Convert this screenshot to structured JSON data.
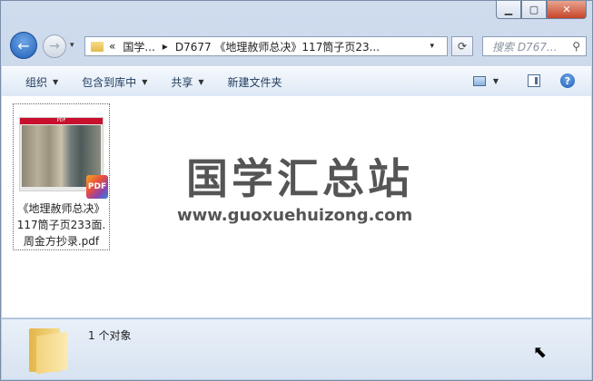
{
  "window": {
    "caption_buttons": {
      "minimize": "▁",
      "maximize": "▢",
      "close": "✕"
    }
  },
  "nav": {
    "back_icon": "←",
    "forward_icon": "→",
    "history_drop": "▾",
    "breadcrumb": [
      "«",
      "国学...",
      "▸",
      "D7677 《地理赦师总决》117筒子页23..."
    ],
    "address_drop": "▾",
    "refresh_icon": "⟳",
    "search_placeholder": "搜索 D767...",
    "search_icon": "⚲"
  },
  "toolbar": {
    "organize": "组织",
    "include_library": "包含到库中",
    "share": "共享",
    "new_folder": "新建文件夹",
    "arrow": "▼",
    "help": "?"
  },
  "file": {
    "thumb_header": "PDF",
    "badge": "PDF",
    "name_line1": "《地理赦师总决》",
    "name_line2": "117筒子页233面.",
    "name_line3": "周金方抄录.pdf"
  },
  "watermark": {
    "chinese": "国学汇总站",
    "url": "www.guoxuehuizong.com"
  },
  "status": {
    "count": "1 个对象",
    "cursor": "⬉"
  }
}
